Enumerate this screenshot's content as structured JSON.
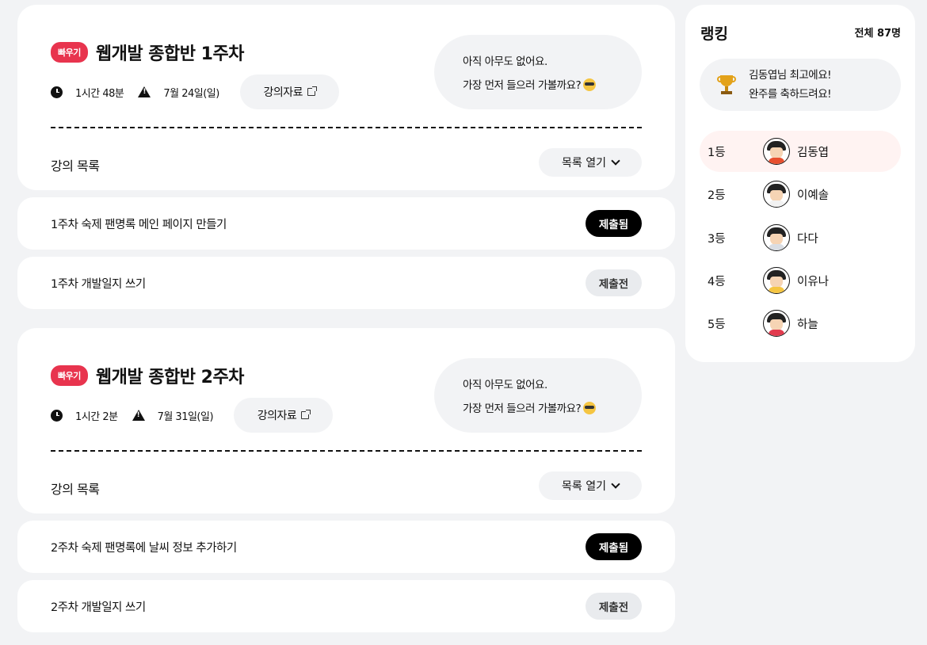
{
  "weeks": [
    {
      "badge": "빠우기",
      "title": "웹개발 종합반 1주차",
      "duration": "1시간 48분",
      "deadline": "7월 24일(일)",
      "material_label": "강의자료",
      "bubble_line1": "아직 아무도 없어요.",
      "bubble_line2": "가장 먼저 들으러 가볼까요?",
      "list_label": "강의 목록",
      "open_label": "목록 열기",
      "homework": [
        {
          "title": "1주차 숙제 팬명록 메인 페이지 만들기",
          "status": "제출됨"
        },
        {
          "title": "1주차 개발일지 쓰기",
          "status": "제출전"
        }
      ]
    },
    {
      "badge": "빠우기",
      "title": "웹개발 종합반 2주차",
      "duration": "1시간 2분",
      "deadline": "7월 31일(일)",
      "material_label": "강의자료",
      "bubble_line1": "아직 아무도 없어요.",
      "bubble_line2": "가장 먼저 들으러 가볼까요?",
      "list_label": "강의 목록",
      "open_label": "목록 열기",
      "homework": [
        {
          "title": "2주차 숙제 팬명록에 날씨 정보 추가하기",
          "status": "제출됨"
        },
        {
          "title": "2주차 개발일지 쓰기",
          "status": "제출전"
        }
      ]
    }
  ],
  "ranking": {
    "title": "랭킹",
    "total": "전체 87명",
    "congrats_line1": "김동엽님 최고에요!",
    "congrats_line2": "완주를 축하드려요!",
    "rows": [
      {
        "rank": "1등",
        "name": "김동엽",
        "color": "#e8502f"
      },
      {
        "rank": "2등",
        "name": "이예솔",
        "color": "#f2f2f2"
      },
      {
        "rank": "3등",
        "name": "다다",
        "color": "#d9dde3"
      },
      {
        "rank": "4등",
        "name": "이유나",
        "color": "#f5c542"
      },
      {
        "rank": "5등",
        "name": "하늘",
        "color": "#e23b4e"
      }
    ]
  },
  "colors": {
    "badge": "#e8344e",
    "background": "#f2f3f5",
    "first_row": "#fff3f2"
  }
}
